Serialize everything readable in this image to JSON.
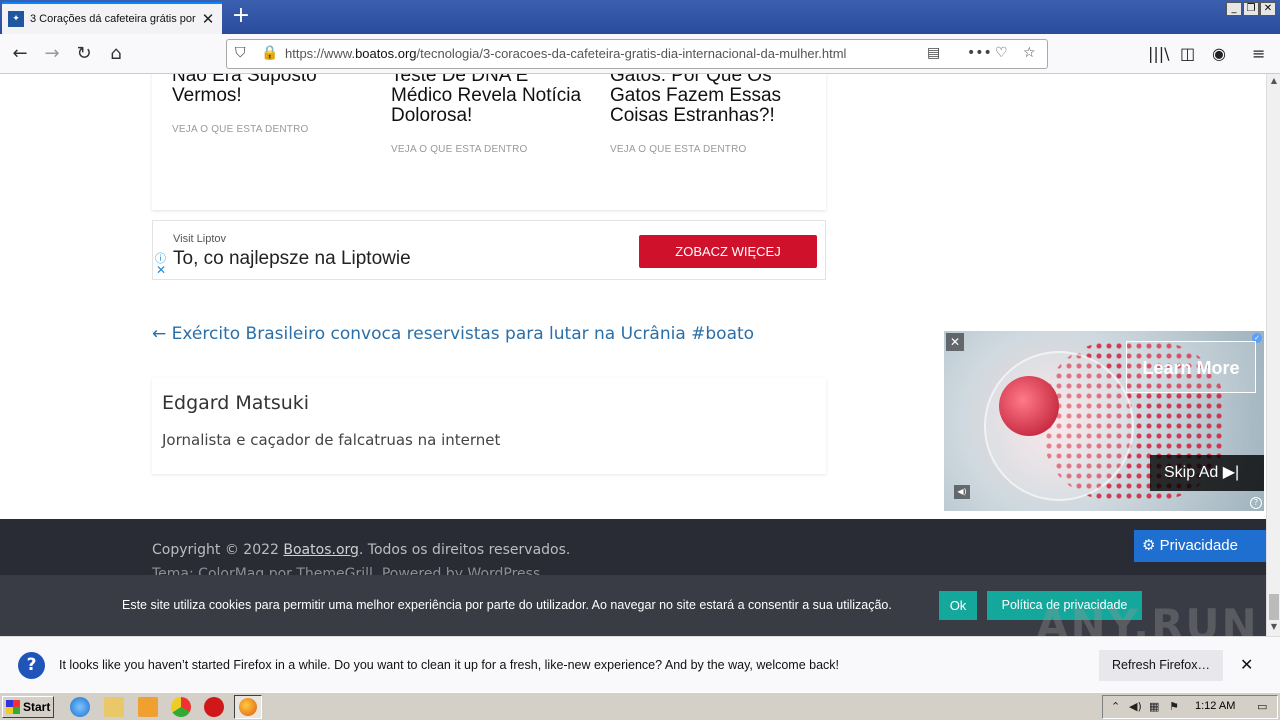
{
  "browser": {
    "tab_title": "3 Corações dá cafeteira grátis por",
    "new_tab": "+",
    "url_prefix": "https://www.",
    "url_domain": "boatos.org",
    "url_path": "/tecnologia/3-coracoes-da-cafeteira-gratis-dia-internacional-da-mulher.html",
    "window_buttons": [
      "_",
      "❐",
      "✕"
    ]
  },
  "related": [
    {
      "title": "Não Era Suposto Vermos!",
      "link": "VEJA O QUE ESTA DENTRO"
    },
    {
      "title": "Teste De DNA E Médico Revela Notícia Dolorosa!",
      "link": "VEJA O QUE ESTA DENTRO"
    },
    {
      "title": "Gatos: Por Que Os Gatos Fazem Essas Coisas Estranhas?!",
      "link": "VEJA O QUE ESTA DENTRO"
    }
  ],
  "ad_banner": {
    "advertiser": "Visit Liptov",
    "headline": "To, co najlepsze na Liptowie",
    "cta": "ZOBACZ WIĘCEJ"
  },
  "prev_post": "← Exército Brasileiro convoca reservistas para lutar na Ucrânia #boato",
  "author": {
    "name": "Edgard Matsuki",
    "bio": "Jornalista e caçador de falcatruas na internet"
  },
  "video_ad": {
    "learn_more": "Learn More",
    "skip": "Skip Ad ▶|"
  },
  "footer": {
    "copyright_prefix": "Copyright © 2022 ",
    "site": "Boatos.org",
    "copyright_suffix": ". Todos os direitos reservados.",
    "theme": "Tema: ColorMag por ThemeGrill. Powered by WordPress."
  },
  "cookie": {
    "message": "Este site utiliza cookies para permitir uma melhor experiência por parte do utilizador. Ao navegar no site estará a consentir a sua utilização.",
    "ok": "Ok",
    "policy": "Política de privacidade",
    "privacy_button": "⚙ Privacidade"
  },
  "notification": {
    "text": "It looks like you haven’t started Firefox in a while. Do you want to clean it up for a fresh, like-new experience? And by the way, welcome back!",
    "button": "Refresh Firefox…",
    "close": "✕"
  },
  "taskbar": {
    "start": "Start",
    "clock": "1:12 AM"
  },
  "watermark": "ANY.RUN"
}
